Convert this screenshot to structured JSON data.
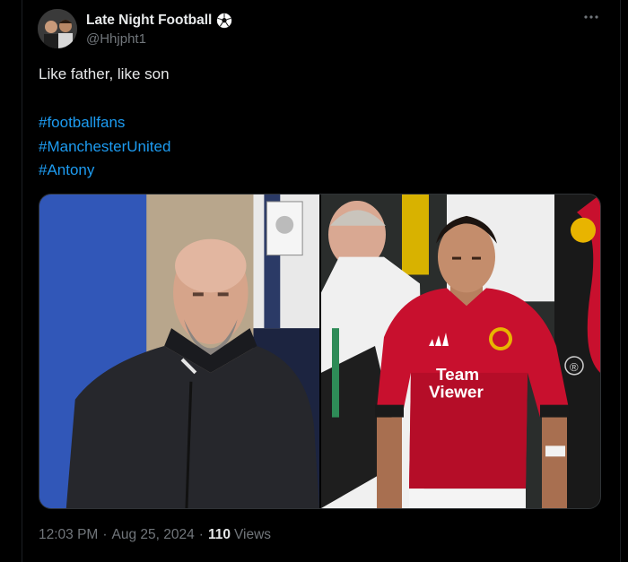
{
  "author": {
    "display_name": "Late Night Football",
    "handle": "@Hhjpht1",
    "badge_icon": "soccer-ball-icon"
  },
  "tweet": {
    "text": "Like father, like son",
    "hashtags": [
      "#footballfans",
      "#ManchesterUnited",
      "#Antony"
    ],
    "time": "12:03 PM",
    "date": "Aug 25, 2024",
    "views_count": "110",
    "views_label": "Views"
  },
  "media": {
    "sponsor_line1": "Team",
    "sponsor_line2": "Viewer",
    "registered_mark": "®"
  },
  "colors": {
    "background": "#000000",
    "text": "#e7e9ea",
    "muted": "#71767b",
    "link": "#1d9bf0",
    "jersey_red": "#c8102e"
  }
}
